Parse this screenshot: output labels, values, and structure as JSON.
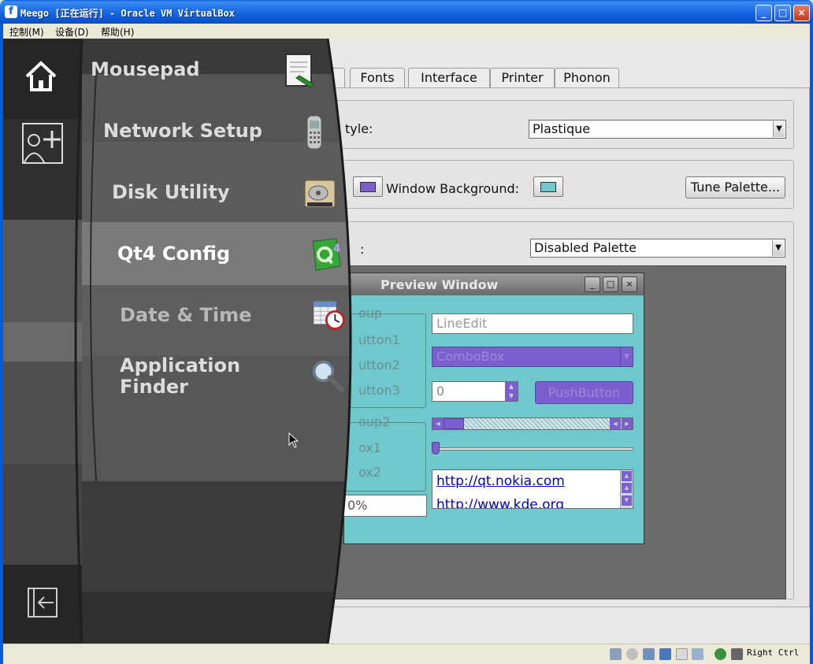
{
  "window": {
    "title": "Meego [正在运行] - Oracle VM VirtualBox",
    "logo_glyph": "f",
    "buttons": {
      "minimize": "_",
      "maximize": "□",
      "close": "×"
    }
  },
  "menu": {
    "items": [
      {
        "label": "控制(M)"
      },
      {
        "label": "设备(D)"
      },
      {
        "label": "帮助(H)"
      }
    ]
  },
  "qtconfig": {
    "tabs": [
      "Fonts",
      "Interface",
      "Printer",
      "Phonon"
    ],
    "style_label": "tyle:",
    "style_value": "Plastique",
    "window_background_label": "Window Background:",
    "tune_palette_button": "Tune Palette...",
    "palette_label": ":",
    "palette_value": "Disabled Palette",
    "swatch_colors": {
      "first": "#7b5fcf",
      "window_background": "#6ec8cc"
    }
  },
  "preview": {
    "title": "Preview Window",
    "buttons": {
      "minimize": "_",
      "maximize": "□",
      "close": "×"
    },
    "group1_title": "oup",
    "group1_items": [
      "utton1",
      "utton2",
      "utton3"
    ],
    "group2_title": "oup2",
    "group2_items": [
      "ox1",
      "ox2"
    ],
    "progress_text": "0%",
    "line_edit": "LineEdit",
    "combo_box": "ComboBox",
    "spin_value": "0",
    "push_button": "PushButton",
    "links": [
      "http://qt.nokia.com",
      "http://www.kde.org"
    ],
    "accent_color": "#7b5fcf",
    "bg_color": "#6ec8cc"
  },
  "launcher": {
    "side_icons": [
      "home-icon",
      "add-user-icon",
      "exit-icon"
    ],
    "items": [
      {
        "label": "Mousepad",
        "icon": "mousepad-icon"
      },
      {
        "label": "Network Setup",
        "icon": "phone-icon"
      },
      {
        "label": "Disk Utility",
        "icon": "hard-disk-icon"
      },
      {
        "label": "Qt4 Config",
        "icon": "qt-icon"
      },
      {
        "label": "Date & Time",
        "icon": "calendar-clock-icon"
      },
      {
        "label": "Application\nFinder",
        "icon": "magnifier-icon"
      }
    ]
  },
  "statusbar": {
    "host_key": "Right Ctrl"
  }
}
